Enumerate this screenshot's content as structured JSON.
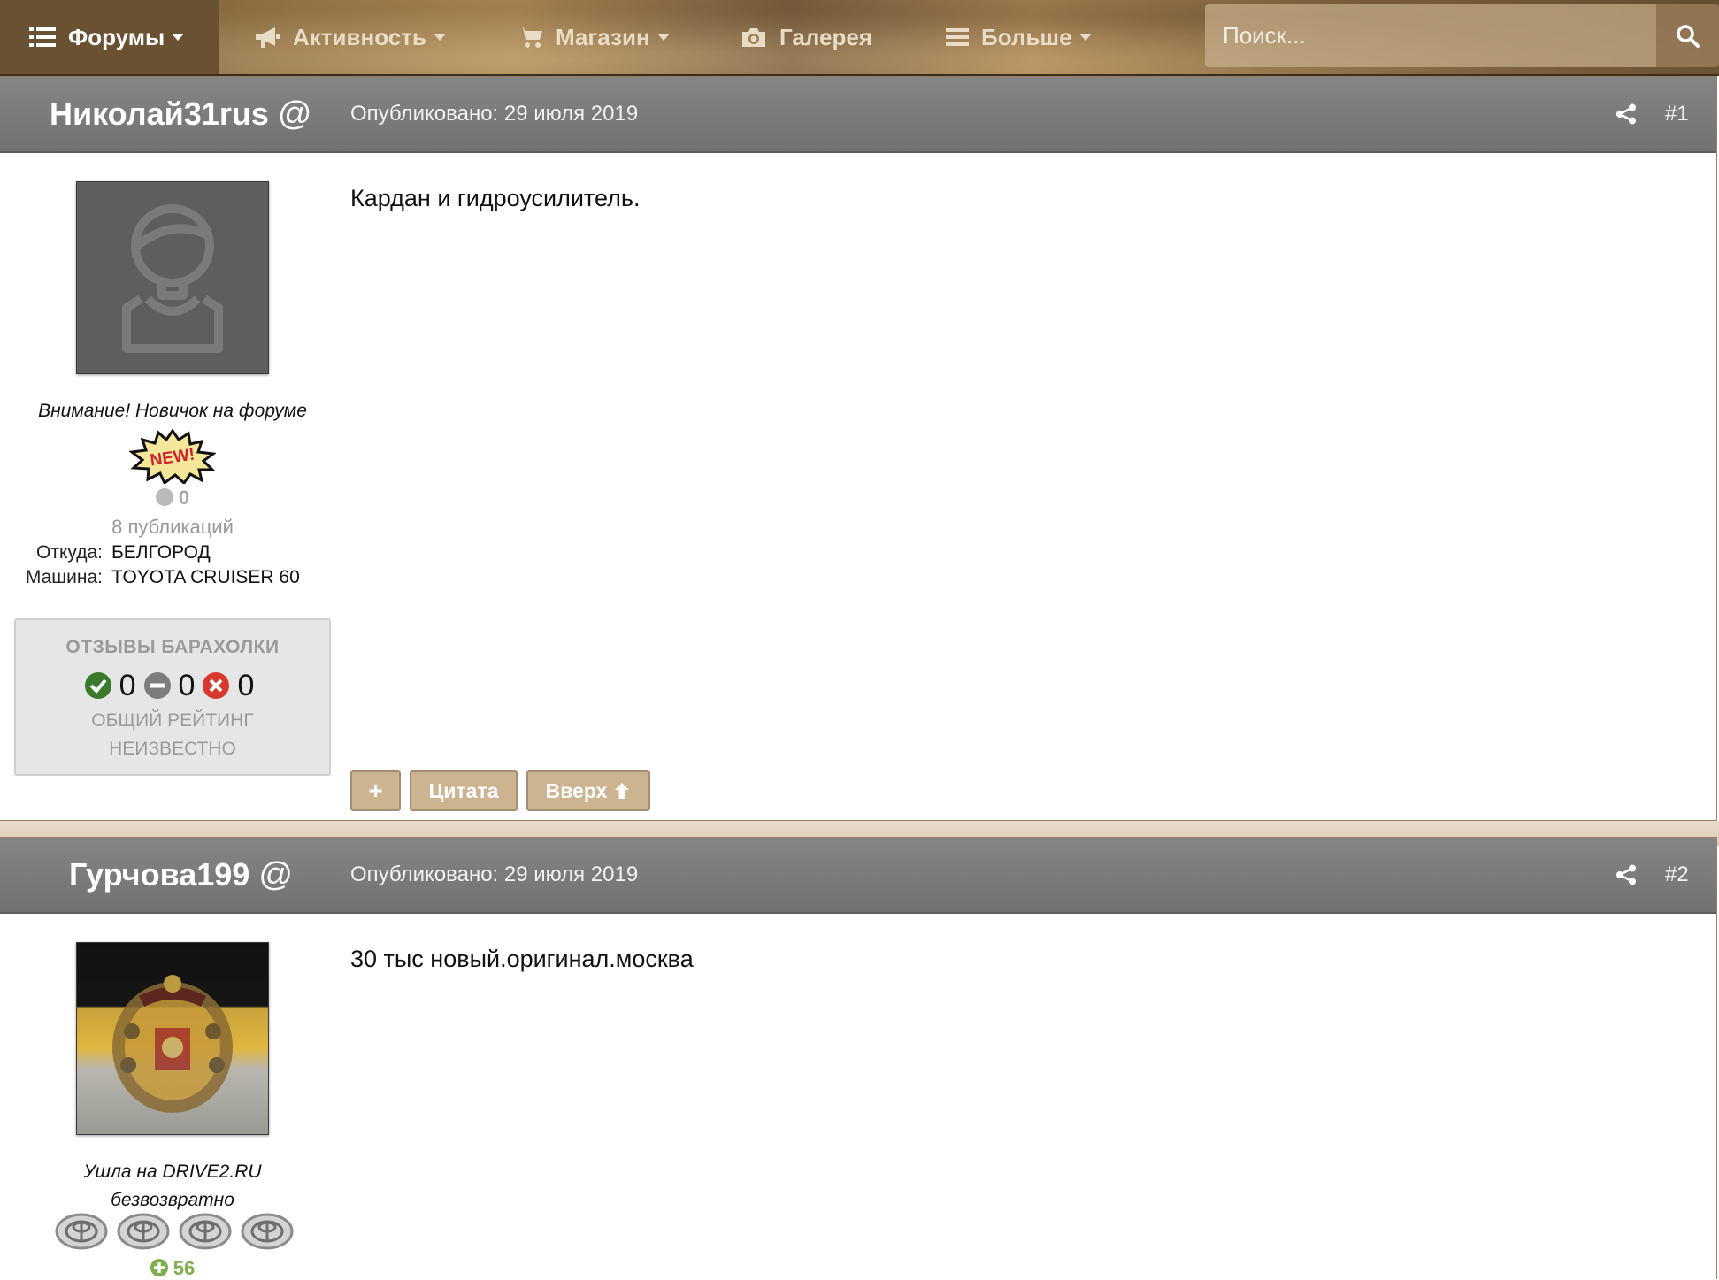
{
  "nav": {
    "items": [
      {
        "label": "Форумы",
        "icon": "list-icon"
      },
      {
        "label": "Активность",
        "icon": "megaphone-icon"
      },
      {
        "label": "Магазин",
        "icon": "cart-icon"
      },
      {
        "label": "Галерея",
        "icon": "camera-icon"
      },
      {
        "label": "Больше",
        "icon": "menu-icon"
      }
    ],
    "search_placeholder": "Поиск...",
    "accent": "#8c6d42"
  },
  "posts": [
    {
      "author": "Николай31rus",
      "at": "@",
      "date": "Опубликовано: 29 июля 2019",
      "number": "#1",
      "user_title": "Внимание! Новичок на форуме",
      "badge": "NEW!",
      "reputation": "0",
      "post_count": "8 публикаций",
      "from_label": "Откуда:",
      "from_value": "БЕЛГОРОД",
      "car_label": "Машина:",
      "car_value": "TOYOTA CRUISER 60",
      "feedback": {
        "title": "ОТЗЫВЫ БАРАХОЛКИ",
        "positive": "0",
        "neutral": "0",
        "negative": "0",
        "rating_line1": "ОБЩИЙ РЕЙТИНГ",
        "rating_line2": "НЕИЗВЕСТНО"
      },
      "body": "Кардан и гидроусилитель.",
      "buttons": {
        "plus": "+",
        "quote": "Цитата",
        "top": "Вверх"
      }
    },
    {
      "author": "Гурчова199",
      "at": "@",
      "date": "Опубликовано: 29 июля 2019",
      "number": "#2",
      "user_title_line1": "Ушла на DRIVE2.RU",
      "user_title_line2": "безвозвратно",
      "reputation": "56",
      "body": "30 тыс новый.оригинал.москва"
    }
  ],
  "colors": {
    "header_gray": "#7b7b7b",
    "button_tan": "#cdb490",
    "positive_green": "#3a7a2a",
    "negative_red": "#d9392c",
    "rep_green": "#7fae4c"
  }
}
